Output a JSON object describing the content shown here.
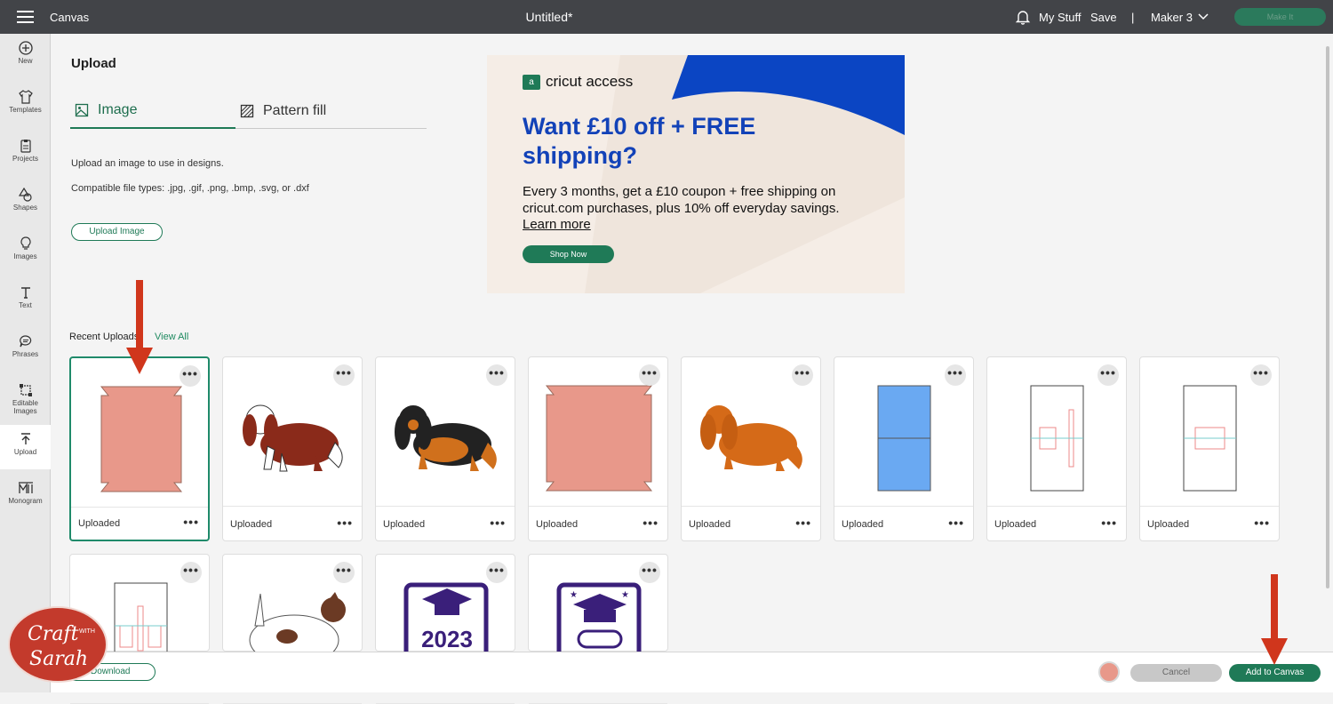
{
  "topbar": {
    "app_name": "Canvas",
    "doc_title": "Untitled*",
    "my_stuff": "My Stuff",
    "save": "Save",
    "separator": "|",
    "machine": "Maker 3",
    "make_it": "Make It"
  },
  "sidebar": {
    "items": [
      {
        "label": "New",
        "icon": "plus-circle-icon"
      },
      {
        "label": "Templates",
        "icon": "shirt-icon"
      },
      {
        "label": "Projects",
        "icon": "clipboard-icon"
      },
      {
        "label": "Shapes",
        "icon": "shapes-icon"
      },
      {
        "label": "Images",
        "icon": "lightbulb-icon"
      },
      {
        "label": "Text",
        "icon": "text-icon"
      },
      {
        "label": "Phrases",
        "icon": "speech-bubble-icon"
      },
      {
        "label": "Editable Images",
        "icon": "edit-shape-icon"
      },
      {
        "label": "Upload",
        "icon": "upload-icon"
      },
      {
        "label": "Monogram",
        "icon": "monogram-icon"
      }
    ]
  },
  "upload": {
    "title": "Upload",
    "tab_image": "Image",
    "tab_pattern": "Pattern fill",
    "desc1": "Upload an image to use in designs.",
    "desc2": "Compatible file types: .jpg, .gif, .png, .bmp, .svg, or .dxf",
    "upload_button": "Upload Image"
  },
  "banner": {
    "logo_mark": "a",
    "logo_text": "cricut access",
    "headline": "Want £10 off + FREE shipping?",
    "body": "Every 3 months, get a £10 coupon + free shipping on cricut.com purchases, plus 10% off everyday savings.",
    "link": "Learn more",
    "cta": "Shop Now"
  },
  "recent": {
    "label": "Recent Uploads",
    "view_all": "View All",
    "card_label": "Uploaded",
    "dots": "•••",
    "cards": [
      {
        "thumb": "box-template-pink"
      },
      {
        "thumb": "spaniel-red"
      },
      {
        "thumb": "spaniel-black-tan"
      },
      {
        "thumb": "box-template-pink"
      },
      {
        "thumb": "spaniel-orange"
      },
      {
        "thumb": "blue-rectangle"
      },
      {
        "thumb": "line-template-a"
      },
      {
        "thumb": "line-template-b"
      },
      {
        "thumb": "line-template-c"
      },
      {
        "thumb": "terrier"
      },
      {
        "thumb": "graduation-2023"
      },
      {
        "thumb": "graduation-cap-scroll"
      }
    ]
  },
  "footer": {
    "download": "Download",
    "cancel": "Cancel",
    "add_to_canvas": "Add to Canvas"
  },
  "watermark": {
    "text_top": "Craft",
    "text_mid": "WITH",
    "text_bottom": "Sarah"
  },
  "colors": {
    "brand_green": "#1f7a57",
    "topbar": "#424448",
    "banner_blue": "#1242b8",
    "arrow_red": "#d0361c",
    "swatch": "#e8988a"
  }
}
